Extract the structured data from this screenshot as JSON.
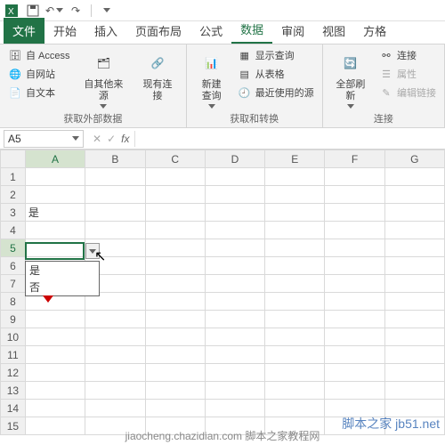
{
  "qat": {
    "save": "保存",
    "undo": "撤销",
    "redo": "恢复"
  },
  "tabs": {
    "file": "文件",
    "home": "开始",
    "insert": "插入",
    "layout": "页面布局",
    "formulas": "公式",
    "data": "数据",
    "review": "审阅",
    "view": "视图",
    "grid": "方格"
  },
  "ribbon": {
    "g1": {
      "access": "自 Access",
      "web": "自网站",
      "text": "自文本",
      "other": "自其他来源",
      "existing": "现有连接",
      "label": "获取外部数据"
    },
    "g2": {
      "newquery": "新建\n查询",
      "showq": "显示查询",
      "fromtable": "从表格",
      "recent": "最近使用的源",
      "label": "获取和转换"
    },
    "g3": {
      "refresh": "全部刷新",
      "conn": "连接",
      "prop": "属性",
      "editlink": "编辑链接",
      "label": "连接"
    }
  },
  "namebox": {
    "ref": "A5",
    "fx": "fx"
  },
  "cols": [
    "A",
    "B",
    "C",
    "D",
    "E",
    "F",
    "G"
  ],
  "rows": [
    "1",
    "2",
    "3",
    "4",
    "5",
    "6",
    "7",
    "8",
    "9",
    "10",
    "11",
    "12",
    "13",
    "14",
    "15"
  ],
  "cells": {
    "A3": "是"
  },
  "dropdown": {
    "opt1": "是",
    "opt2": "否"
  },
  "watermark": "脚本之家 jb51.net",
  "footer": "jiaocheng.chazidian.com 脚本之家教程网"
}
